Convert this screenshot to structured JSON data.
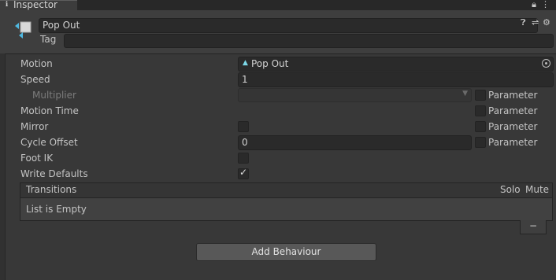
{
  "window": {
    "tab_label": "Inspector",
    "tab_icon": "info-icon",
    "tab_tools": [
      "lock-icon",
      "menu-icon"
    ]
  },
  "header": {
    "name": "Pop Out",
    "tag_label": "Tag",
    "tag_value": "",
    "icons": [
      "help-icon",
      "settings-sliders-icon",
      "gear-icon"
    ]
  },
  "properties": {
    "motion": {
      "label": "Motion",
      "value": "Pop Out"
    },
    "speed": {
      "label": "Speed",
      "value": "1"
    },
    "multiplier": {
      "label": "Multiplier",
      "value": "",
      "parameter_label": "Parameter",
      "parameter_checked": false
    },
    "motion_time": {
      "label": "Motion Time",
      "parameter_label": "Parameter",
      "parameter_checked": false
    },
    "mirror": {
      "label": "Mirror",
      "checked": false,
      "parameter_label": "Parameter",
      "parameter_checked": false
    },
    "cycle_offset": {
      "label": "Cycle Offset",
      "value": "0",
      "parameter_label": "Parameter",
      "parameter_checked": false
    },
    "foot_ik": {
      "label": "Foot IK",
      "checked": false
    },
    "write_defaults": {
      "label": "Write Defaults",
      "checked": true
    }
  },
  "transitions": {
    "title": "Transitions",
    "solo_label": "Solo",
    "mute_label": "Mute",
    "empty_text": "List is Empty",
    "remove_label": "−"
  },
  "add_behaviour_label": "Add Behaviour",
  "colors": {
    "background": "#383838",
    "field": "#2a2a2a",
    "motion_icon": "#7dd8e8",
    "button": "#585858"
  }
}
